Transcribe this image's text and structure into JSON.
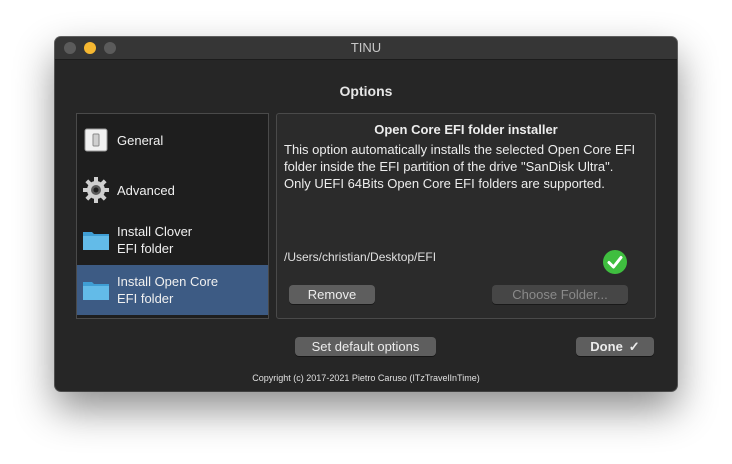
{
  "window": {
    "title": "TINU"
  },
  "heading": "Options",
  "sidebar": {
    "items": [
      {
        "label": "General",
        "icon": "general-icon",
        "selected": false
      },
      {
        "label": "Advanced",
        "icon": "gear-icon",
        "selected": false
      },
      {
        "label": "Install Clover\nEFI folder",
        "icon": "folder-icon",
        "selected": false
      },
      {
        "label": "Install Open Core\nEFI folder",
        "icon": "folder-icon",
        "selected": true
      }
    ]
  },
  "panel": {
    "title": "Open Core EFI folder installer",
    "description": "This option automatically installs the selected Open Core EFI folder inside the EFI partition of the drive \"SanDisk Ultra\".\nOnly UEFI 64Bits Open Core EFI folders are supported.",
    "path": "/Users/christian/Desktop/EFI",
    "remove_label": "Remove",
    "choose_label": "Choose Folder..."
  },
  "footer": {
    "default_label": "Set default options",
    "done_label": "Done",
    "done_check": "✓",
    "copyright": "Copyright (c) 2017-2021 Pietro Caruso (ITzTravelInTime)"
  },
  "colors": {
    "accent_selected": "#3d5b84",
    "minimize_light": "#f5b731",
    "check_green": "#3fbe3f"
  }
}
